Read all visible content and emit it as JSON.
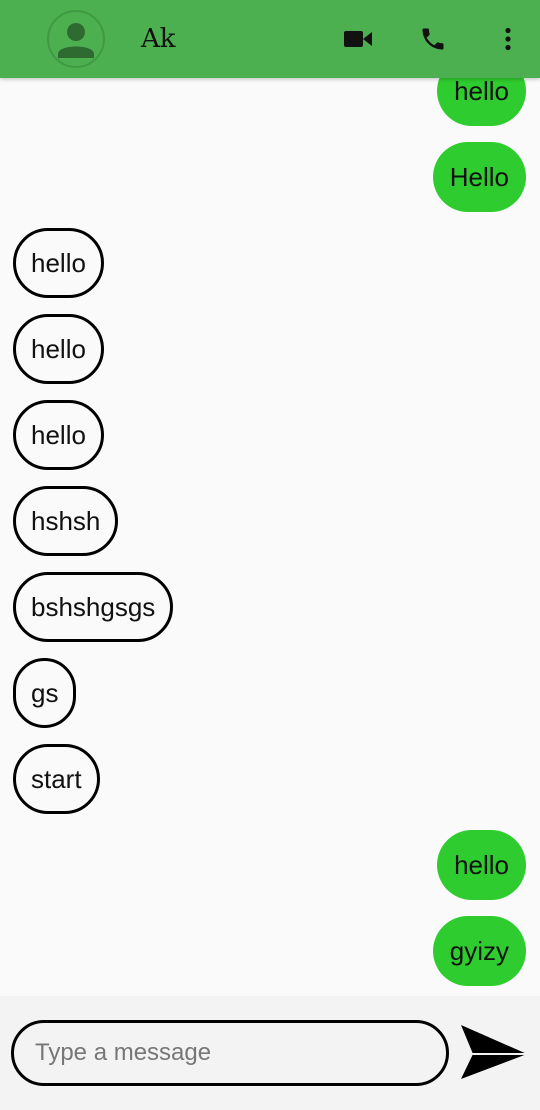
{
  "header": {
    "contact_name": "Ak",
    "avatar_icon": "person-icon",
    "actions": [
      "video-camera-icon",
      "phone-icon",
      "more-vertical-icon"
    ]
  },
  "messages": [
    {
      "text": "hello",
      "direction": "outgoing"
    },
    {
      "text": "Hello",
      "direction": "outgoing"
    },
    {
      "text": "hello",
      "direction": "incoming"
    },
    {
      "text": "hello",
      "direction": "incoming"
    },
    {
      "text": "hello",
      "direction": "incoming"
    },
    {
      "text": "hshsh",
      "direction": "incoming"
    },
    {
      "text": "bshshgsgs",
      "direction": "incoming"
    },
    {
      "text": "gs",
      "direction": "incoming"
    },
    {
      "text": "start",
      "direction": "incoming"
    },
    {
      "text": "hello",
      "direction": "outgoing"
    },
    {
      "text": "gyizy",
      "direction": "outgoing"
    }
  ],
  "composer": {
    "placeholder": "Type a message",
    "value": "",
    "send_icon": "send-icon"
  },
  "colors": {
    "app_bar": "#4caf50",
    "outgoing_bubble": "#2ecc2e",
    "background": "#fafafa"
  }
}
